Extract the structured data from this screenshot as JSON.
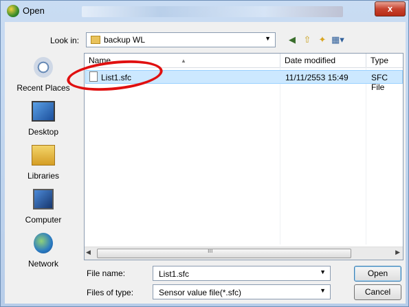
{
  "window": {
    "title": "Open",
    "close_glyph": "x"
  },
  "toolbar": {
    "look_in_label": "Look in:",
    "look_in_value": "backup WL",
    "icons": [
      "back-icon",
      "up-folder-icon",
      "new-folder-icon",
      "views-menu-icon"
    ]
  },
  "places": [
    {
      "label": "Recent Places",
      "icon": "recent-places-icon"
    },
    {
      "label": "Desktop",
      "icon": "desktop-icon"
    },
    {
      "label": "Libraries",
      "icon": "libraries-icon"
    },
    {
      "label": "Computer",
      "icon": "computer-icon"
    },
    {
      "label": "Network",
      "icon": "network-icon"
    }
  ],
  "file_list": {
    "columns": [
      "Name",
      "Date modified",
      "Type"
    ],
    "rows": [
      {
        "name": "List1.sfc",
        "date_modified": "11/11/2553 15:49",
        "type": "SFC File",
        "selected": true
      }
    ]
  },
  "filename": {
    "label": "File name:",
    "value": "List1.sfc"
  },
  "filetype": {
    "label": "Files of type:",
    "value": "Sensor value file(*.sfc)"
  },
  "buttons": {
    "open": "Open",
    "cancel": "Cancel"
  },
  "annotation": {
    "color": "#e01010",
    "shape": "ellipse around List1.sfc row"
  }
}
